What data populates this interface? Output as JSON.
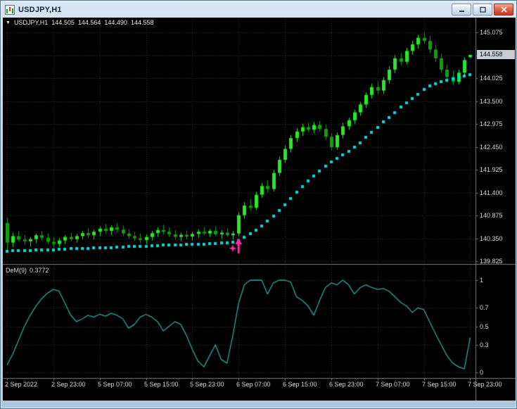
{
  "window": {
    "title": "USDJPY,H1"
  },
  "titlebar_controls": {
    "minimize": "minimize",
    "maximize": "maximize",
    "close": "close"
  },
  "chart": {
    "collapse_icon": "▼",
    "symbol_label": "USDJPY,H1",
    "ohlc": {
      "open": "144.505",
      "high": "144.564",
      "low": "144.490",
      "close": "144.558"
    },
    "bid_tag": "144.558",
    "price_axis_labels": [
      "145.075",
      "144.025",
      "143.500",
      "142.975",
      "142.450",
      "141.925",
      "141.400",
      "140.875",
      "140.350",
      "139.825"
    ],
    "indicator_label": {
      "name": "DeM(9)",
      "value": "0.3772"
    },
    "indicator_axis_labels": [
      "1",
      "0.7",
      "0.5",
      "0.3",
      "0"
    ]
  },
  "colors": {
    "background": "#000000",
    "grid": "#343434",
    "bull": "#2be62b",
    "bear": "#0fa00f",
    "trend_dots": "#00dcdc",
    "dem_line": "#2fa79e",
    "signal": "#ff2ba6",
    "axis_text": "#d6d6d6",
    "separator": "#7d7d7d",
    "bid_tag_bg": "#c9ced6",
    "bid_tag_text": "#000000"
  },
  "chart_data": {
    "type": "candlestick",
    "symbol": "USDJPY",
    "timeframe": "H1",
    "y_axis": {
      "min": 139.825,
      "max": 145.075,
      "step": 0.525
    },
    "x_ticks": [
      {
        "label": "2 Sep 2022",
        "index": 0
      },
      {
        "label": "2 Sep 23:00",
        "index": 8
      },
      {
        "label": "5 Sep 07:00",
        "index": 16
      },
      {
        "label": "5 Sep 15:00",
        "index": 24
      },
      {
        "label": "5 Sep 23:00",
        "index": 32
      },
      {
        "label": "6 Sep 07:00",
        "index": 40
      },
      {
        "label": "6 Sep 15:00",
        "index": 48
      },
      {
        "label": "6 Sep 23:00",
        "index": 56
      },
      {
        "label": "7 Sep 07:00",
        "index": 64
      },
      {
        "label": "7 Sep 15:00",
        "index": 72
      },
      {
        "label": "7 Sep 23:00",
        "index": 80
      }
    ],
    "candles": [
      [
        140.7,
        140.82,
        140.08,
        140.25
      ],
      [
        140.25,
        140.48,
        140.15,
        140.4
      ],
      [
        140.4,
        140.52,
        140.28,
        140.32
      ],
      [
        140.32,
        140.42,
        140.2,
        140.28
      ],
      [
        140.28,
        140.38,
        140.16,
        140.33
      ],
      [
        140.33,
        140.46,
        140.24,
        140.42
      ],
      [
        140.42,
        140.52,
        140.3,
        140.36
      ],
      [
        140.36,
        140.46,
        140.22,
        140.27
      ],
      [
        140.27,
        140.37,
        140.14,
        140.22
      ],
      [
        140.22,
        140.35,
        140.15,
        140.3
      ],
      [
        140.3,
        140.42,
        140.22,
        140.38
      ],
      [
        140.38,
        140.48,
        140.28,
        140.33
      ],
      [
        140.33,
        140.45,
        140.25,
        140.4
      ],
      [
        140.4,
        140.52,
        140.32,
        140.47
      ],
      [
        140.47,
        140.58,
        140.36,
        140.42
      ],
      [
        140.42,
        140.55,
        140.33,
        140.5
      ],
      [
        140.5,
        140.62,
        140.4,
        140.57
      ],
      [
        140.57,
        140.68,
        140.45,
        140.52
      ],
      [
        140.52,
        140.65,
        140.42,
        140.6
      ],
      [
        140.6,
        140.7,
        140.48,
        140.55
      ],
      [
        140.55,
        140.64,
        140.4,
        140.46
      ],
      [
        140.46,
        140.56,
        140.34,
        140.4
      ],
      [
        140.4,
        140.5,
        140.28,
        140.35
      ],
      [
        140.35,
        140.46,
        140.24,
        140.31
      ],
      [
        140.31,
        140.44,
        140.22,
        140.38
      ],
      [
        140.38,
        140.52,
        140.3,
        140.47
      ],
      [
        140.47,
        140.6,
        140.38,
        140.54
      ],
      [
        140.54,
        140.66,
        140.44,
        140.5
      ],
      [
        140.5,
        140.6,
        140.38,
        140.44
      ],
      [
        140.44,
        140.54,
        140.32,
        140.38
      ],
      [
        140.38,
        140.48,
        140.28,
        140.43
      ],
      [
        140.43,
        140.53,
        140.33,
        140.39
      ],
      [
        140.39,
        140.5,
        140.3,
        140.45
      ],
      [
        140.45,
        140.56,
        140.36,
        140.5
      ],
      [
        140.5,
        140.6,
        140.42,
        140.46
      ],
      [
        140.46,
        140.56,
        140.38,
        140.52
      ],
      [
        140.52,
        140.62,
        140.4,
        140.44
      ],
      [
        140.44,
        140.54,
        140.34,
        140.48
      ],
      [
        140.48,
        140.58,
        140.38,
        140.42
      ],
      [
        140.42,
        140.52,
        140.32,
        140.46
      ],
      [
        140.46,
        140.95,
        140.4,
        140.88
      ],
      [
        140.88,
        141.18,
        140.8,
        141.1
      ],
      [
        141.1,
        141.25,
        140.98,
        141.05
      ],
      [
        141.05,
        141.42,
        141.0,
        141.35
      ],
      [
        141.35,
        141.62,
        141.28,
        141.55
      ],
      [
        141.55,
        141.68,
        141.4,
        141.48
      ],
      [
        141.48,
        141.92,
        141.42,
        141.85
      ],
      [
        141.85,
        142.22,
        141.78,
        142.15
      ],
      [
        142.15,
        142.48,
        142.08,
        142.4
      ],
      [
        142.4,
        142.72,
        142.32,
        142.65
      ],
      [
        142.65,
        142.88,
        142.56,
        142.8
      ],
      [
        142.8,
        142.98,
        142.7,
        142.9
      ],
      [
        142.9,
        143.0,
        142.78,
        142.84
      ],
      [
        142.84,
        143.02,
        142.76,
        142.95
      ],
      [
        142.95,
        143.04,
        142.8,
        142.86
      ],
      [
        142.86,
        142.96,
        142.6,
        142.68
      ],
      [
        142.68,
        142.76,
        142.36,
        142.44
      ],
      [
        142.44,
        142.78,
        142.38,
        142.72
      ],
      [
        142.72,
        143.0,
        142.64,
        142.92
      ],
      [
        142.92,
        143.12,
        142.84,
        143.06
      ],
      [
        143.06,
        143.3,
        142.98,
        143.24
      ],
      [
        143.24,
        143.48,
        143.16,
        143.42
      ],
      [
        143.42,
        143.7,
        143.34,
        143.64
      ],
      [
        143.64,
        143.9,
        143.56,
        143.82
      ],
      [
        143.82,
        143.95,
        143.66,
        143.74
      ],
      [
        143.74,
        144.05,
        143.66,
        143.98
      ],
      [
        143.98,
        144.3,
        143.9,
        144.22
      ],
      [
        144.22,
        144.55,
        144.14,
        144.48
      ],
      [
        144.48,
        144.6,
        144.32,
        144.4
      ],
      [
        144.4,
        144.72,
        144.34,
        144.65
      ],
      [
        144.65,
        144.88,
        144.56,
        144.8
      ],
      [
        144.8,
        145.02,
        144.7,
        144.95
      ],
      [
        144.95,
        145.07,
        144.82,
        144.88
      ],
      [
        144.88,
        145.0,
        144.6,
        144.68
      ],
      [
        144.68,
        144.8,
        144.4,
        144.48
      ],
      [
        144.48,
        144.58,
        144.15,
        144.22
      ],
      [
        144.22,
        144.34,
        143.96,
        144.05
      ],
      [
        144.05,
        144.2,
        143.86,
        143.94
      ],
      [
        143.94,
        144.22,
        143.88,
        144.15
      ],
      [
        144.15,
        144.5,
        144.08,
        144.44
      ],
      [
        144.505,
        144.564,
        144.49,
        144.558
      ]
    ],
    "trend_dots": [
      140.05,
      140.06,
      140.06,
      140.07,
      140.07,
      140.08,
      140.08,
      140.09,
      140.09,
      140.1,
      140.1,
      140.11,
      140.11,
      140.12,
      140.12,
      140.13,
      140.13,
      140.14,
      140.14,
      140.15,
      140.15,
      140.16,
      140.16,
      140.17,
      140.17,
      140.18,
      140.18,
      140.19,
      140.19,
      140.2,
      140.2,
      140.21,
      140.21,
      140.22,
      140.22,
      140.23,
      140.23,
      140.24,
      140.25,
      140.26,
      140.3,
      140.38,
      140.46,
      140.54,
      140.64,
      140.74,
      140.86,
      140.98,
      141.12,
      141.26,
      141.4,
      141.54,
      141.66,
      141.78,
      141.9,
      142.0,
      142.1,
      142.18,
      142.26,
      142.34,
      142.44,
      142.54,
      142.66,
      142.78,
      142.9,
      143.02,
      143.12,
      143.24,
      143.36,
      143.46,
      143.56,
      143.66,
      143.76,
      143.84,
      143.9,
      143.94,
      143.98,
      144.01,
      144.04,
      144.07,
      144.1
    ],
    "signal_markers": [
      {
        "shape": "up-arrow",
        "index": 40,
        "price": 140.36
      },
      {
        "shape": "star",
        "index": 39,
        "price": 140.12
      }
    ],
    "indicator": {
      "type": "line",
      "name": "DeMarker",
      "period": 9,
      "last_value": 0.3772,
      "range": [
        0,
        1
      ],
      "levels": [
        0.3,
        0.5,
        0.7
      ],
      "values": [
        0.08,
        0.2,
        0.35,
        0.5,
        0.62,
        0.72,
        0.8,
        0.86,
        0.9,
        0.88,
        0.75,
        0.62,
        0.55,
        0.58,
        0.62,
        0.6,
        0.63,
        0.61,
        0.64,
        0.62,
        0.58,
        0.48,
        0.52,
        0.6,
        0.63,
        0.6,
        0.55,
        0.45,
        0.5,
        0.55,
        0.52,
        0.4,
        0.25,
        0.12,
        0.06,
        0.18,
        0.3,
        0.14,
        0.1,
        0.4,
        0.75,
        0.95,
        1.0,
        1.0,
        1.0,
        0.85,
        0.97,
        1.0,
        1.0,
        0.98,
        0.82,
        0.78,
        0.72,
        0.62,
        0.78,
        0.92,
        0.97,
        0.95,
        1.0,
        0.95,
        0.85,
        0.92,
        0.95,
        0.92,
        0.9,
        0.91,
        0.88,
        0.82,
        0.76,
        0.72,
        0.65,
        0.7,
        0.68,
        0.55,
        0.42,
        0.3,
        0.18,
        0.1,
        0.06,
        0.04,
        0.3772
      ]
    }
  }
}
